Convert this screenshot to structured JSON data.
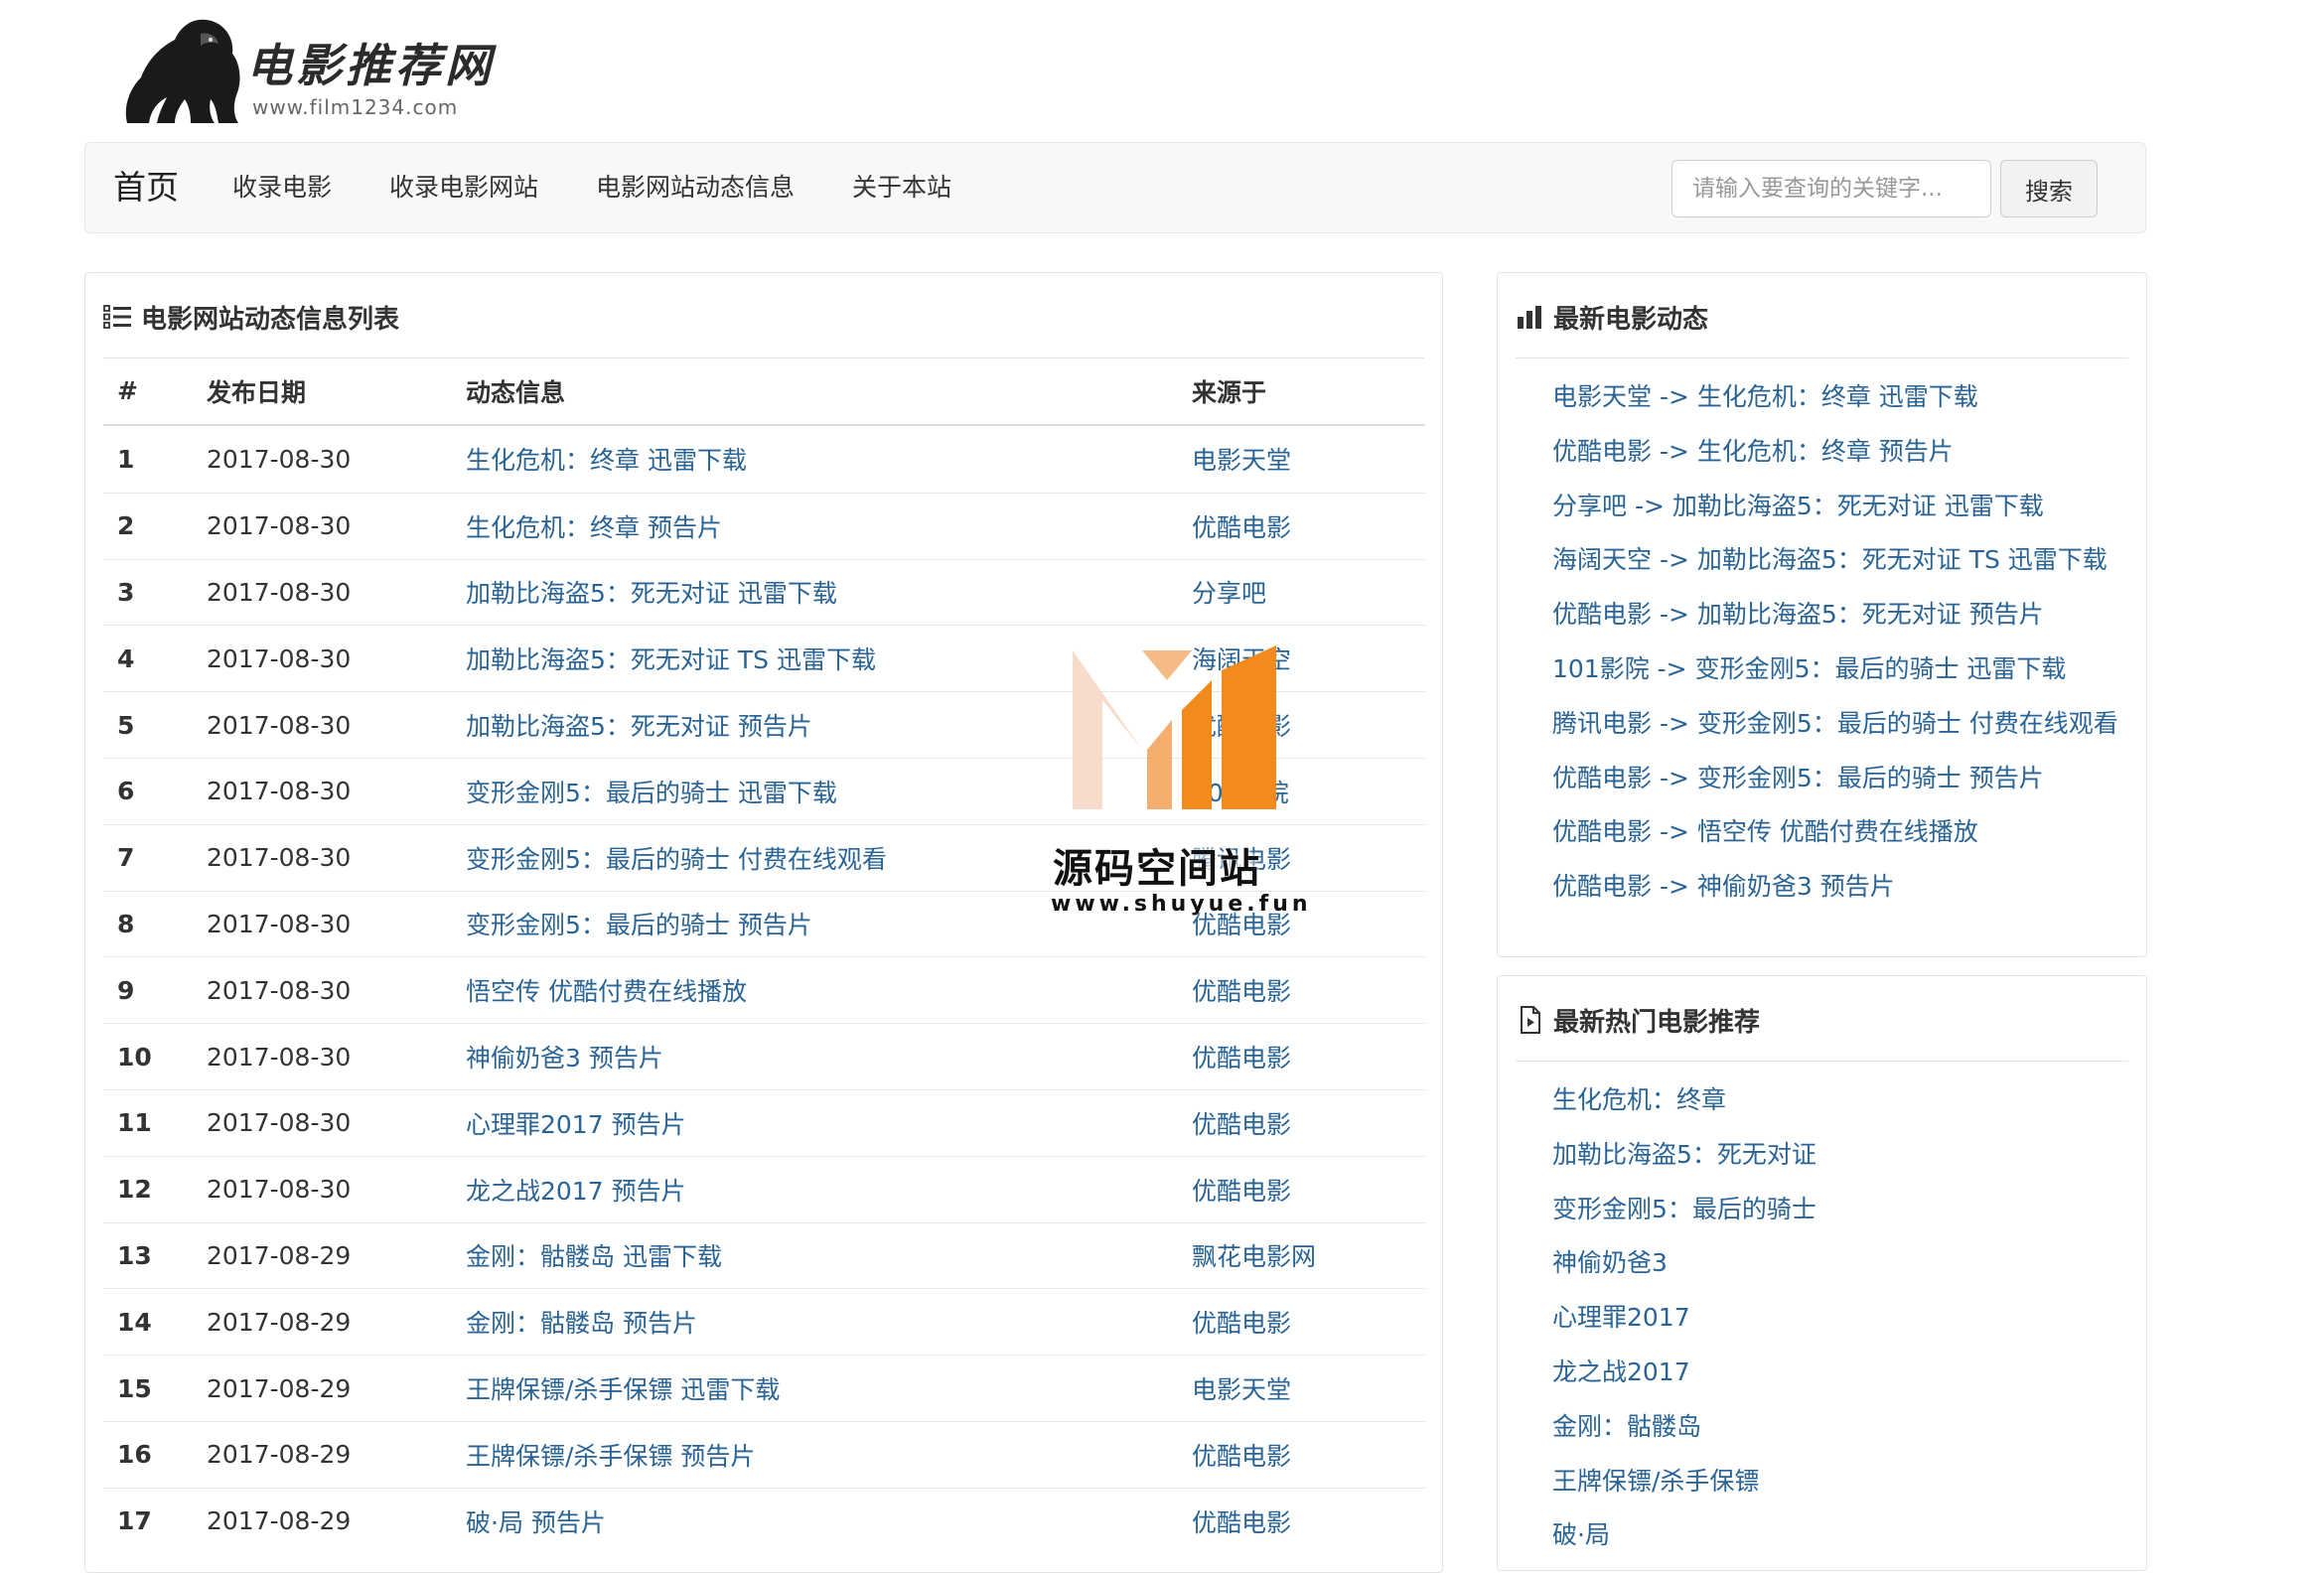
{
  "logo": {
    "title": "电影推荐网",
    "url": "www.film1234.com"
  },
  "nav": {
    "brand": "首页",
    "items": [
      "收录电影",
      "收录电影网站",
      "电影网站动态信息",
      "关于本站"
    ],
    "search_placeholder": "请输入要查询的关键字...",
    "search_button": "搜索"
  },
  "main_panel": {
    "title": "电影网站动态信息列表",
    "icon": "list-icon",
    "columns": [
      "#",
      "发布日期",
      "动态信息",
      "来源于"
    ],
    "rows": [
      {
        "num": "1",
        "date": "2017-08-30",
        "info": "生化危机：终章 迅雷下载",
        "source": "电影天堂"
      },
      {
        "num": "2",
        "date": "2017-08-30",
        "info": "生化危机：终章 预告片",
        "source": "优酷电影"
      },
      {
        "num": "3",
        "date": "2017-08-30",
        "info": "加勒比海盗5：死无对证 迅雷下载",
        "source": "分享吧"
      },
      {
        "num": "4",
        "date": "2017-08-30",
        "info": "加勒比海盗5：死无对证 TS 迅雷下载",
        "source": "海阔天空"
      },
      {
        "num": "5",
        "date": "2017-08-30",
        "info": "加勒比海盗5：死无对证 预告片",
        "source": "优酷电影"
      },
      {
        "num": "6",
        "date": "2017-08-30",
        "info": "变形金刚5：最后的骑士 迅雷下载",
        "source": "101影院"
      },
      {
        "num": "7",
        "date": "2017-08-30",
        "info": "变形金刚5：最后的骑士 付费在线观看",
        "source": "腾讯电影"
      },
      {
        "num": "8",
        "date": "2017-08-30",
        "info": "变形金刚5：最后的骑士 预告片",
        "source": "优酷电影"
      },
      {
        "num": "9",
        "date": "2017-08-30",
        "info": "悟空传 优酷付费在线播放",
        "source": "优酷电影"
      },
      {
        "num": "10",
        "date": "2017-08-30",
        "info": "神偷奶爸3 预告片",
        "source": "优酷电影"
      },
      {
        "num": "11",
        "date": "2017-08-30",
        "info": "心理罪2017 预告片",
        "source": "优酷电影"
      },
      {
        "num": "12",
        "date": "2017-08-30",
        "info": "龙之战2017 预告片",
        "source": "优酷电影"
      },
      {
        "num": "13",
        "date": "2017-08-29",
        "info": "金刚：骷髅岛 迅雷下载",
        "source": "飘花电影网"
      },
      {
        "num": "14",
        "date": "2017-08-29",
        "info": "金刚：骷髅岛 预告片",
        "source": "优酷电影"
      },
      {
        "num": "15",
        "date": "2017-08-29",
        "info": "王牌保镖/杀手保镖 迅雷下载",
        "source": "电影天堂"
      },
      {
        "num": "16",
        "date": "2017-08-29",
        "info": "王牌保镖/杀手保镖 预告片",
        "source": "优酷电影"
      },
      {
        "num": "17",
        "date": "2017-08-29",
        "info": "破·局 预告片",
        "source": "优酷电影"
      }
    ]
  },
  "news_panel": {
    "title": "最新电影动态",
    "icon": "bar-chart-icon",
    "items": [
      "电影天堂 -> 生化危机：终章 迅雷下载",
      "优酷电影 -> 生化危机：终章 预告片",
      "分享吧 -> 加勒比海盗5：死无对证 迅雷下载",
      "海阔天空 -> 加勒比海盗5：死无对证 TS 迅雷下载",
      "优酷电影 -> 加勒比海盗5：死无对证 预告片",
      "101影院 -> 变形金刚5：最后的骑士 迅雷下载",
      "腾讯电影 -> 变形金刚5：最后的骑士 付费在线观看",
      "优酷电影 -> 变形金刚5：最后的骑士 预告片",
      "优酷电影 -> 悟空传 优酷付费在线播放",
      "优酷电影 -> 神偷奶爸3 预告片"
    ]
  },
  "hot_panel": {
    "title": "最新热门电影推荐",
    "icon": "movie-file-icon",
    "items": [
      "生化危机：终章",
      "加勒比海盗5：死无对证",
      "变形金刚5：最后的骑士",
      "神偷奶爸3",
      "心理罪2017",
      "龙之战2017",
      "金刚：骷髅岛",
      "王牌保镖/杀手保镖",
      "破·局"
    ]
  },
  "watermark": {
    "title": "源码空间站",
    "url": "www.shuyue.fun"
  },
  "colors": {
    "link": "#2a6496",
    "navbar_bg": "#f8f8f8",
    "watermark_orange": "#f28a1c"
  }
}
